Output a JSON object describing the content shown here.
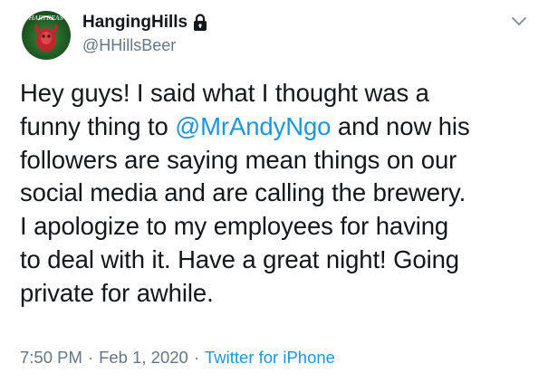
{
  "author": {
    "display_name": "HangingHills",
    "handle": "@HHillsBeer",
    "avatar_text": "HARTREAS",
    "protected_icon": "lock-icon"
  },
  "menu": {
    "icon": "chevron-down-icon"
  },
  "tweet": {
    "line1": "Hey guys! I said what I thought was a",
    "line2_prefix": "funny thing to ",
    "line2_mention": "@MrAndyNgo",
    "line2_suffix": " and now his",
    "line3": "followers are saying mean things on our",
    "line4": "social media and are calling the brewery.",
    "line5": "I apologize to my employees for having",
    "line6": "to deal with it. Have a great night! Going",
    "line7": "private for awhile."
  },
  "meta": {
    "time": "7:50 PM",
    "separator": "·",
    "date": "Feb 1, 2020",
    "source": "Twitter for iPhone"
  },
  "colors": {
    "link": "#1b95e0",
    "secondary_text": "#657786",
    "primary_text": "#14171a"
  }
}
